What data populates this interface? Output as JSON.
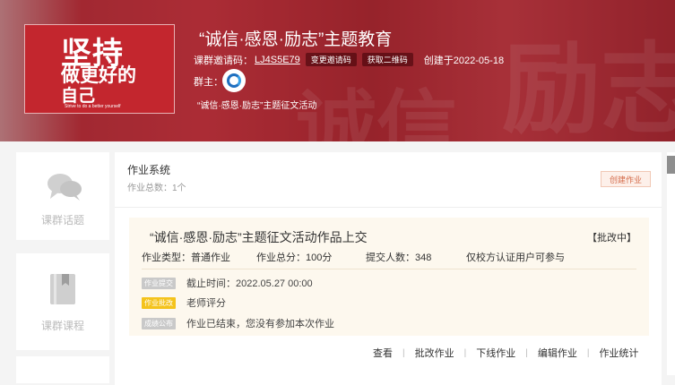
{
  "course": {
    "title": "“诚信·感恩·励志”主题教育",
    "invite_label": "课群邀请码：",
    "invite_code": "LJ4S5E79",
    "change_invite_btn": "变更邀请码",
    "qr_btn": "获取二维码",
    "created": "创建于2022-05-18",
    "owner_label": "群主：",
    "activity_name": "“诚信·感恩·励志”主题征文活动",
    "cover": {
      "line1": "坚持",
      "line2": "做更好的",
      "line3": "自己",
      "small": "Strive to do a better yourself"
    }
  },
  "sidebar": {
    "items": [
      {
        "label": "课群话题",
        "icon": "chat-bubbles-icon"
      },
      {
        "label": "课群课程",
        "icon": "book-icon"
      }
    ]
  },
  "homework": {
    "system_title": "作业系统",
    "total": "作业总数：1个",
    "create_btn": "创建作业",
    "task": {
      "title": "“诚信·感恩·励志”主题征文活动作品上交",
      "status": "【批改中】",
      "type": "作业类型：普通作业",
      "score": "作业总分：100分",
      "submitters": "提交人数：348",
      "access": "仅校方认证用户可参与",
      "steps": [
        {
          "tag": "作业提交",
          "text": "截止时间：2022.05.27 00:00",
          "color": "#c9c9c9"
        },
        {
          "tag": "作业批改",
          "text": "老师评分",
          "color": "#f4c31c"
        },
        {
          "tag": "成绩公布",
          "text": "作业已结束，您没有参加本次作业",
          "color": "#c9c9c9"
        }
      ]
    },
    "actions": [
      "查看",
      "批改作业",
      "下线作业",
      "编辑作业",
      "作业统计"
    ]
  }
}
